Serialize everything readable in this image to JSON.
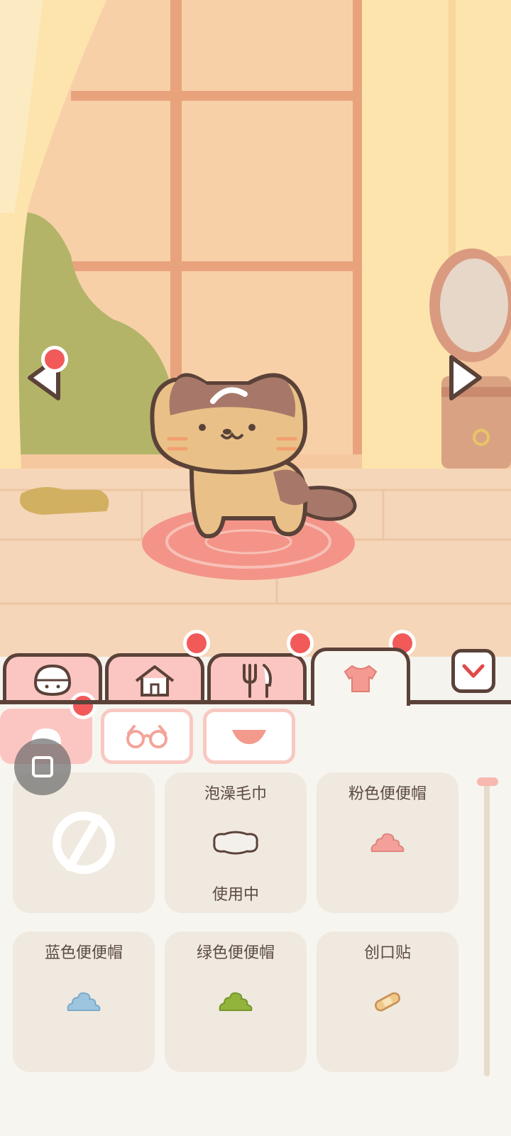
{
  "tabs": [
    {
      "icon": "cat-face-icon",
      "active": false
    },
    {
      "icon": "house-icon",
      "active": false
    },
    {
      "icon": "fork-knife-icon",
      "active": false
    },
    {
      "icon": "shirt-icon",
      "active": true
    }
  ],
  "subcategories": [
    {
      "icon": "hat-icon",
      "active": true
    },
    {
      "icon": "glasses-icon",
      "active": false
    },
    {
      "icon": "collar-icon",
      "active": false
    }
  ],
  "items": [
    {
      "name": "",
      "status": "",
      "icon": "none-icon"
    },
    {
      "name": "泡澡毛巾",
      "status": "使用中",
      "icon": "towel-icon"
    },
    {
      "name": "粉色便便帽",
      "status": "",
      "icon": "pink-poop-hat-icon"
    },
    {
      "name": "蓝色便便帽",
      "status": "",
      "icon": "blue-poop-hat-icon"
    },
    {
      "name": "绿色便便帽",
      "status": "",
      "icon": "green-poop-hat-icon"
    },
    {
      "name": "创口贴",
      "status": "",
      "icon": "bandage-icon"
    }
  ],
  "colors": {
    "accent": "#fbc6c2",
    "outline": "#5b4239",
    "badge": "#f25a5a",
    "card": "#efe9df",
    "pink_poop": "#f4a09a",
    "blue_poop": "#9cc6e0",
    "green_poop": "#93b43c"
  }
}
